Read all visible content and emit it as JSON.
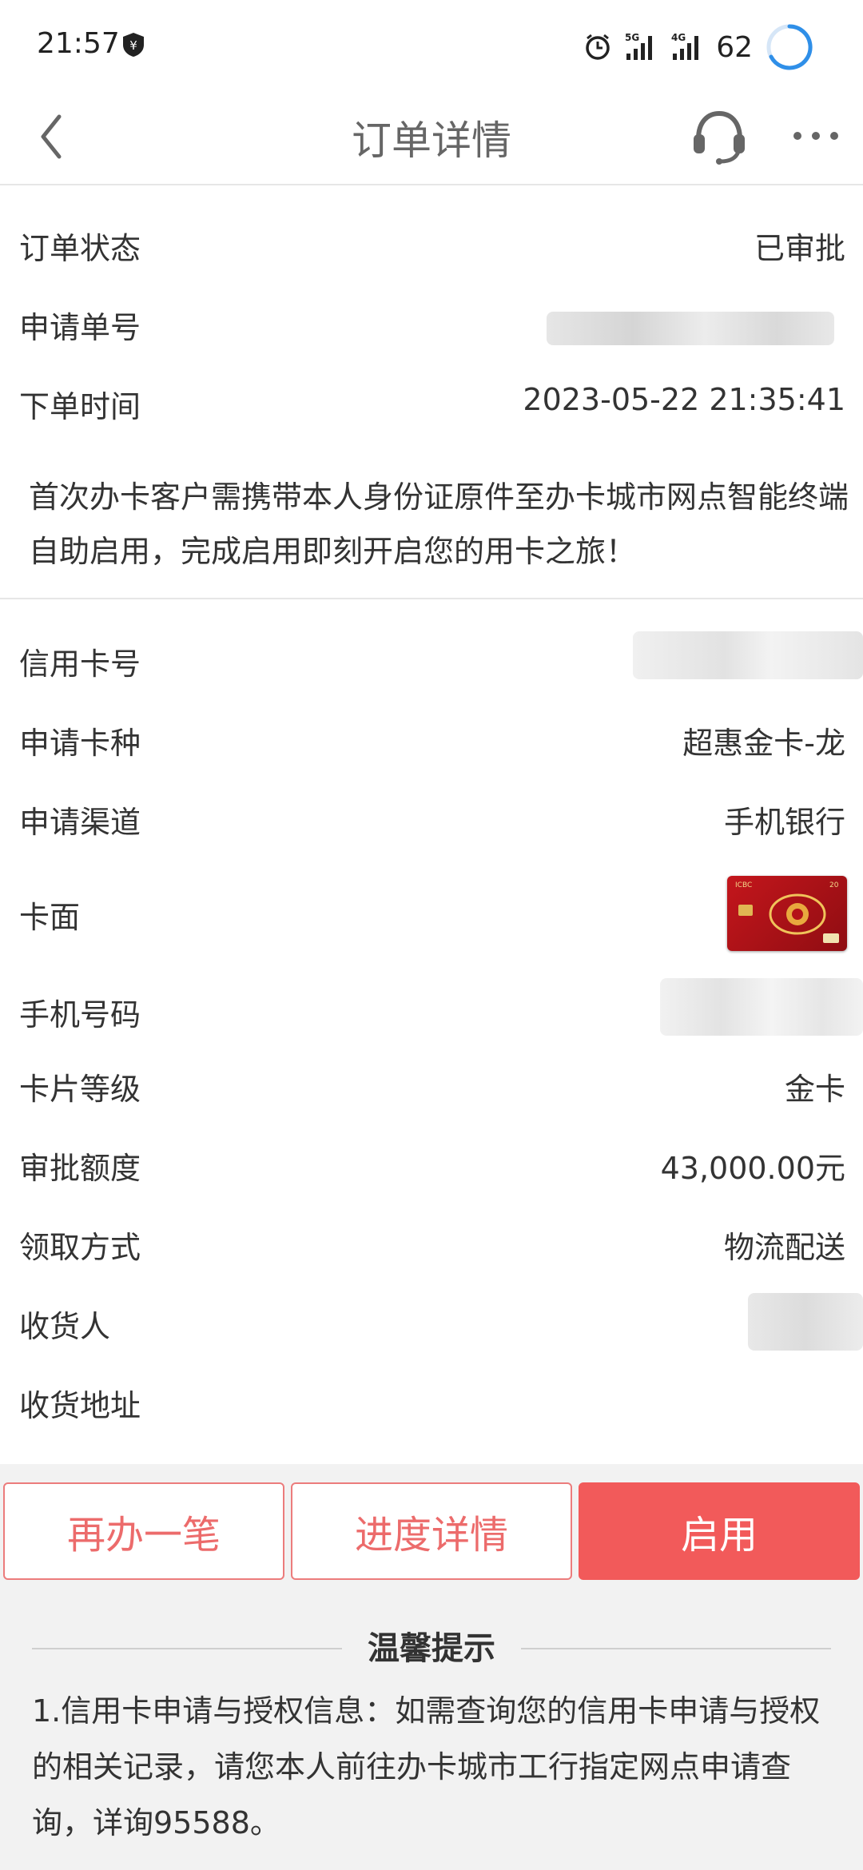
{
  "status_bar": {
    "time": "21:57",
    "network_5g": "5G",
    "network_4g": "4G",
    "battery": "62"
  },
  "nav": {
    "title": "订单详情"
  },
  "order": {
    "status_label": "订单状态",
    "status_value": "已审批",
    "app_no_label": "申请单号",
    "time_label": "下单时间",
    "time_value": "2023-05-22 21:35:41",
    "notice": "首次办卡客户需携带本人身份证原件至办卡城市网点智能终端自助启用，完成启用即刻开启您的用卡之旅！"
  },
  "card_info": {
    "card_no_label": "信用卡号",
    "card_type_label": "申请卡种",
    "card_type_value": "超惠金卡-龙",
    "channel_label": "申请渠道",
    "channel_value": "手机银行",
    "face_label": "卡面",
    "phone_label": "手机号码",
    "level_label": "卡片等级",
    "level_value": "金卡",
    "limit_label": "审批额度",
    "limit_value": "43,000.00元",
    "delivery_label": "领取方式",
    "delivery_value": "物流配送",
    "receiver_label": "收货人",
    "address_label": "收货地址"
  },
  "buttons": {
    "reapply": "再办一笔",
    "progress": "进度详情",
    "activate": "启用"
  },
  "tips": {
    "title": "温馨提示",
    "text": "1.信用卡申请与授权信息：如需查询您的信用卡申请与授权的相关记录，请您本人前往办卡城市工行指定网点申请查询，详询95588。"
  },
  "card_face": {
    "brand": "ICBC",
    "badge": "20"
  },
  "colors": {
    "accent": "#f25a5a",
    "outline": "#ec7c7c",
    "progress_ring": "#2f8fe8"
  }
}
